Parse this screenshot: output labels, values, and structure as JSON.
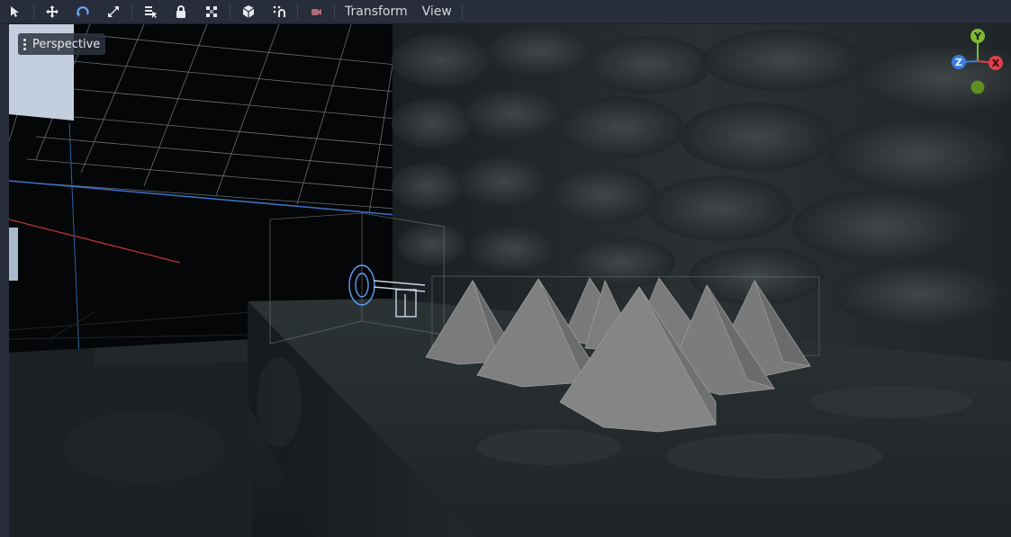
{
  "toolbar": {
    "tools": [
      {
        "icon": "select-arrow-icon"
      },
      {
        "icon": "move-icon"
      },
      {
        "icon": "rotate-icon"
      },
      {
        "icon": "scale-icon"
      },
      {
        "icon": "list-select-icon"
      },
      {
        "icon": "lock-icon"
      },
      {
        "icon": "group-icon"
      },
      {
        "icon": "local-space-icon"
      },
      {
        "icon": "snap-icon"
      },
      {
        "icon": "camera-icon"
      }
    ],
    "menus": {
      "transform": "Transform",
      "view": "View"
    }
  },
  "viewport": {
    "mode_label": "Perspective",
    "gizmo_axes": {
      "y": "Y",
      "z": "Z",
      "x": "X"
    },
    "colors": {
      "x_axis": "#e0404a",
      "y_axis": "#7ebb2e",
      "z_axis": "#3a7fe0",
      "accent": "#5aa2ff"
    }
  }
}
